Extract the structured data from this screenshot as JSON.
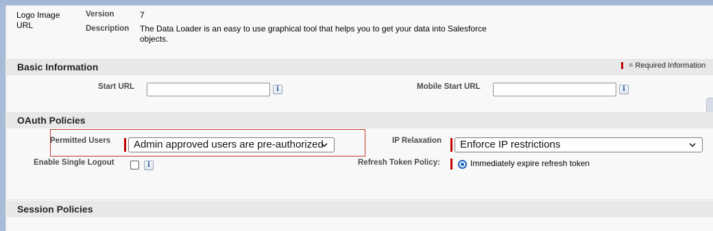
{
  "app_info": {
    "logo_label": "Logo Image URL",
    "version_label": "Version",
    "version_value": "7",
    "description_label": "Description",
    "description_value": "The Data Loader is an easy to use graphical tool that helps you to get your data into Salesforce objects."
  },
  "basic_information": {
    "title": "Basic Information",
    "required_legend": "= Required Information",
    "start_url_label": "Start URL",
    "start_url_value": "",
    "mobile_start_url_label": "Mobile Start URL",
    "mobile_start_url_value": ""
  },
  "oauth_policies": {
    "title": "OAuth Policies",
    "permitted_users_label": "Permitted Users",
    "permitted_users_value": "Admin approved users are pre-authorized",
    "ip_relaxation_label": "IP Relaxation",
    "ip_relaxation_value": "Enforce IP restrictions",
    "enable_single_logout_label": "Enable Single Logout",
    "enable_single_logout_checked": false,
    "refresh_token_policy_label": "Refresh Token Policy:",
    "refresh_token_policy_value": "Immediately expire refresh token"
  },
  "session_policies": {
    "title": "Session Policies"
  },
  "icons": {
    "info": "info-icon",
    "chevron": "chevron-down-icon",
    "radio": "radio-selected-icon"
  },
  "colors": {
    "required": "#c00000",
    "highlight": "#c0392b",
    "radio": "#1a5fc4"
  }
}
